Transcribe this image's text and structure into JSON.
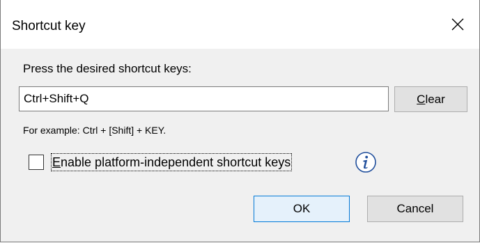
{
  "dialog": {
    "title": "Shortcut key",
    "close_icon": "close-icon"
  },
  "content": {
    "prompt_label": "Press the desired shortcut keys:",
    "shortcut_input": {
      "value": "Ctrl+Shift+Q"
    },
    "clear_button": {
      "mnemonic": "C",
      "rest": "lear"
    },
    "example_text": "For example: Ctrl + [Shift] + KEY.",
    "platform_checkbox": {
      "checked": false,
      "label_mnemonic": "E",
      "label_rest": "nable platform-independent shortcut keys"
    },
    "info_icon": "info-icon"
  },
  "footer": {
    "ok_label": "OK",
    "cancel_label": "Cancel"
  },
  "colors": {
    "dialog_background": "#f0f0f0",
    "titlebar_background": "#ffffff",
    "button_face": "#e1e1e1",
    "default_button_border": "#0078d7",
    "default_button_face": "#e5f1fb",
    "info_icon_color": "#1f4e9c"
  }
}
